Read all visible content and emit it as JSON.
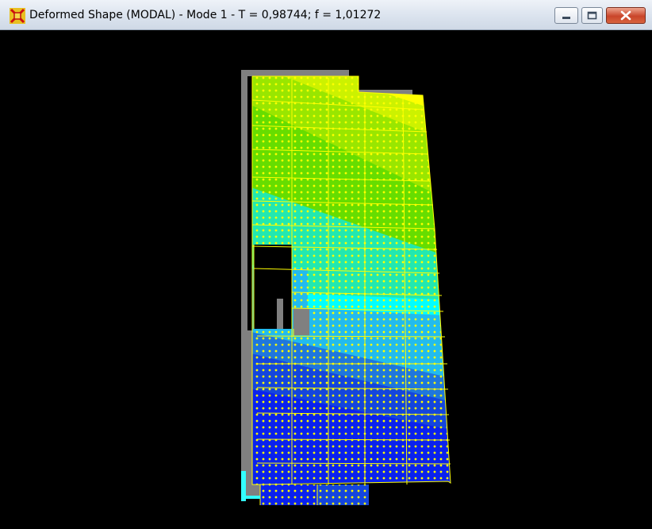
{
  "window": {
    "title": "Deformed Shape (MODAL) - Mode 1 - T = 0,98744;  f = 1,01272",
    "icons": {
      "app": "sap2000-app-icon",
      "minimize": "minimize-icon",
      "maximize": "maximize-icon",
      "close": "close-icon"
    }
  },
  "colors": {
    "background": "#000000",
    "mesh_lines": "#ffff00",
    "undeformed": "#808080",
    "contour_band_1": "#ffff00",
    "contour_band_2": "#ccf200",
    "contour_band_3": "#99e600",
    "contour_band_4": "#66dd00",
    "contour_band_5": "#33dd44",
    "contour_band_6": "#22e8b0",
    "contour_band_7": "#00ffff",
    "contour_band_8": "#22bbee",
    "contour_band_9": "#1f77dd",
    "contour_band_10": "#1446dd",
    "contour_band_11": "#0a22ee"
  }
}
